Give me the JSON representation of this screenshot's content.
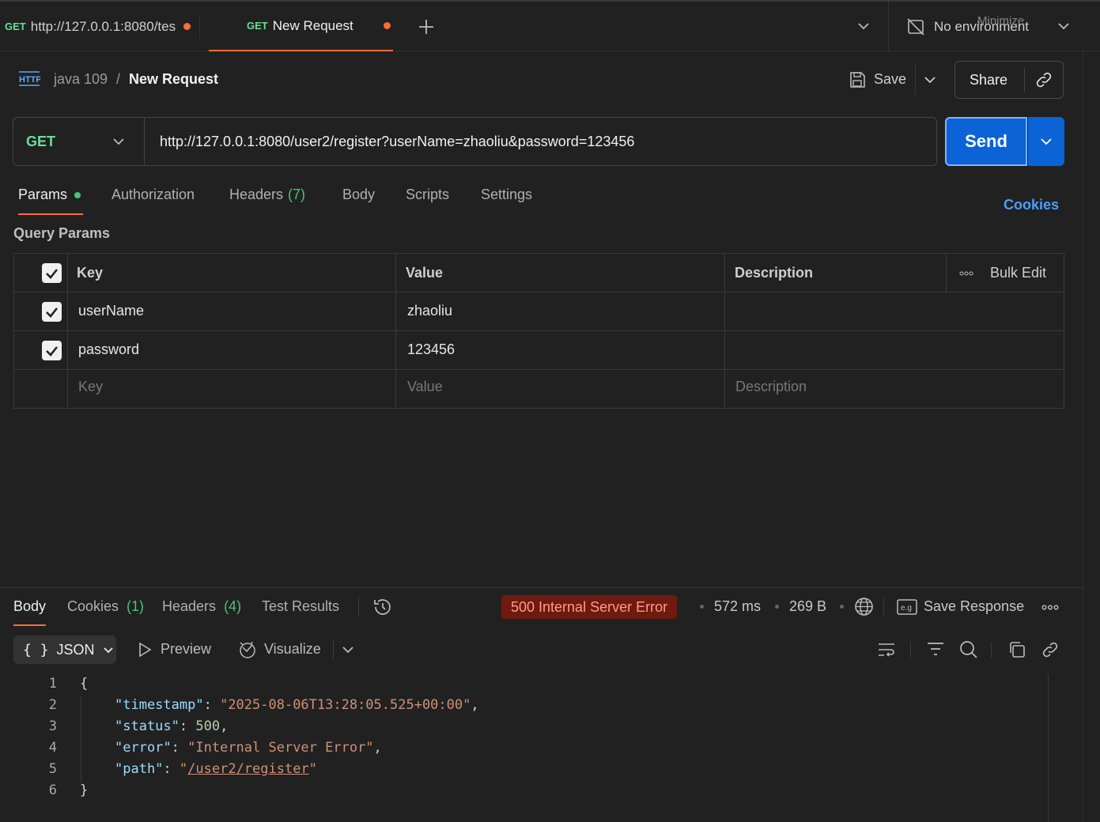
{
  "tabs": [
    {
      "method": "GET",
      "title": "http://127.0.0.1:8080/tes"
    },
    {
      "method": "GET",
      "title": "New Request"
    }
  ],
  "window": {
    "environment": "No environment",
    "minimize_tooltip": "Minimize"
  },
  "breadcrumb": {
    "collection": "java 109",
    "separator": "/",
    "request": "New Request"
  },
  "toolbar": {
    "save": "Save",
    "share": "Share"
  },
  "request": {
    "method": "GET",
    "url": "http://127.0.0.1:8080/user2/register?userName=zhaoliu&password=123456",
    "send": "Send"
  },
  "request_tabs": {
    "params": "Params",
    "authorization": "Authorization",
    "headers": "Headers",
    "headers_count": "(7)",
    "body": "Body",
    "scripts": "Scripts",
    "settings": "Settings",
    "cookies": "Cookies"
  },
  "query_params": {
    "title": "Query Params",
    "columns": {
      "key": "Key",
      "value": "Value",
      "description": "Description",
      "bulk_edit": "Bulk Edit"
    },
    "rows": [
      {
        "key": "userName",
        "value": "zhaoliu"
      },
      {
        "key": "password",
        "value": "123456"
      }
    ],
    "placeholder": {
      "key": "Key",
      "value": "Value",
      "description": "Description"
    }
  },
  "response": {
    "tabs": {
      "body": "Body",
      "cookies": "Cookies",
      "cookies_count": "(1)",
      "headers": "Headers",
      "headers_count": "(4)",
      "test_results": "Test Results"
    },
    "status": "500 Internal Server Error",
    "time": "572 ms",
    "size": "269 B",
    "save_response": "Save Response",
    "format": "JSON",
    "preview": "Preview",
    "visualize": "Visualize",
    "lines": [
      "1",
      "2",
      "3",
      "4",
      "5",
      "6"
    ],
    "json": {
      "open": "{",
      "close": "}",
      "timestamp_key": "\"timestamp\"",
      "timestamp_val": "\"2025-08-06T13:28:05.525+00:00\"",
      "status_key": "\"status\"",
      "status_val": "500",
      "error_key": "\"error\"",
      "error_val": "\"Internal Server Error\"",
      "path_key": "\"path\"",
      "path_q": "\"",
      "path_val": "/user2/register"
    }
  }
}
